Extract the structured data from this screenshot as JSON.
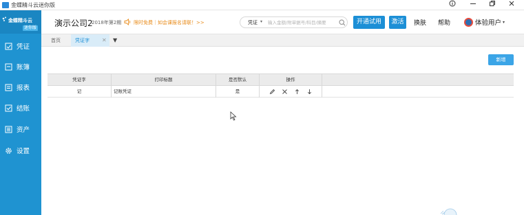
{
  "window": {
    "title": "金蝶精斗云迷你版"
  },
  "sidebar": {
    "logo_text": "金蝶精斗云",
    "logo_tag": "迷你版",
    "items": [
      {
        "label": "凭证",
        "icon": "voucher-icon"
      },
      {
        "label": "账簿",
        "icon": "ledger-icon"
      },
      {
        "label": "报表",
        "icon": "report-icon"
      },
      {
        "label": "结账",
        "icon": "closing-icon"
      },
      {
        "label": "资产",
        "icon": "asset-icon"
      },
      {
        "label": "设置",
        "icon": "settings-icon"
      }
    ]
  },
  "header": {
    "company": "演示公司2",
    "period": "2018年第2期",
    "notice": "限时免费｜如会课报名请联！>>",
    "search": {
      "type": "凭证",
      "placeholder": "输入金额/附单据号/科目/摘要"
    },
    "trial_button": "开通试用",
    "activate_button": "激活",
    "skin_link": "换肤",
    "help_link": "帮助",
    "user_name": "体验用户"
  },
  "tabs": [
    {
      "label": "首页",
      "active": false
    },
    {
      "label": "凭证字",
      "active": true
    }
  ],
  "content": {
    "new_button": "新增",
    "table": {
      "headers": [
        "凭证字",
        "打印标题",
        "是否默认",
        "操作"
      ],
      "rows": [
        {
          "word": "记",
          "print_title": "记账凭证",
          "is_default": "是"
        }
      ]
    }
  },
  "colors": {
    "sidebar_bg": "#1f93d1",
    "accent": "#1c8fd6",
    "notice": "#e88b1a"
  }
}
